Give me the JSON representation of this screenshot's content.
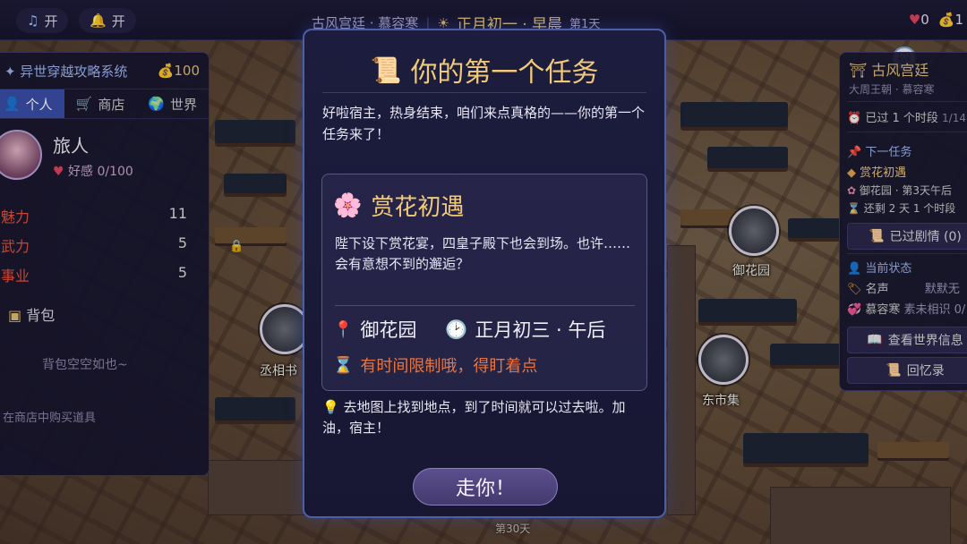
{
  "topbar": {
    "music_label": "开",
    "bell_label": "开",
    "location": "古风宫廷 · 慕容寒",
    "date": "正月初一 · 早晨",
    "day": "第1天",
    "hearts": "0",
    "coins": "1"
  },
  "left_panel": {
    "system_title": "异世穿越攻略系统",
    "coins": "100",
    "tabs": [
      {
        "label": "个人",
        "icon": "person-icon"
      },
      {
        "label": "商店",
        "icon": "cart-icon"
      },
      {
        "label": "世界",
        "icon": "globe-icon"
      }
    ],
    "player_name": "旅人",
    "favor": "好感 0/100",
    "stats": [
      {
        "name": "魅力",
        "value": "11"
      },
      {
        "name": "武力",
        "value": "5"
      },
      {
        "name": "事业",
        "value": "5"
      }
    ],
    "bag_title": "背包",
    "bag_empty": "背包空空如也~",
    "bag_tip": "在商店中购买道具"
  },
  "map": {
    "locations": [
      "御花园",
      "丞相书",
      "东市集"
    ],
    "footer_day": "第30天"
  },
  "right_panel": {
    "title": "古风宫廷",
    "subtitle": "大周王朝 · 慕容寒",
    "elapsed": "已过 1 个时段",
    "elapsed_extra": "1/14",
    "next_task_label": "下一任务",
    "next_task_name": "赏花初遇",
    "next_task_place": "御花园 · 第3天午后",
    "next_task_remain": "还剩 2 天 1 个时段",
    "story_button": "已过剧情 (0)",
    "status_label": "当前状态",
    "reputation_label": "名声",
    "reputation_value": "默默无",
    "relation_label": "慕容寒",
    "relation_value": "素未相识 0/",
    "world_button": "查看世界信息",
    "memory_button": "回忆录"
  },
  "dialog": {
    "title": "你的第一个任务",
    "intro": "好啦宿主，热身结束，咱们来点真格的——你的第一个任务来了！",
    "task_name": "赏花初遇",
    "task_desc": "陛下设下赏花宴，四皇子殿下也会到场。也许……会有意想不到的邂逅？",
    "place": "御花园",
    "time": "正月初三 · 午后",
    "warning": "有时间限制哦，得盯着点",
    "hint": "去地图上找到地点，到了时间就可以过去啦。加油，宿主！",
    "button": "走你！"
  }
}
